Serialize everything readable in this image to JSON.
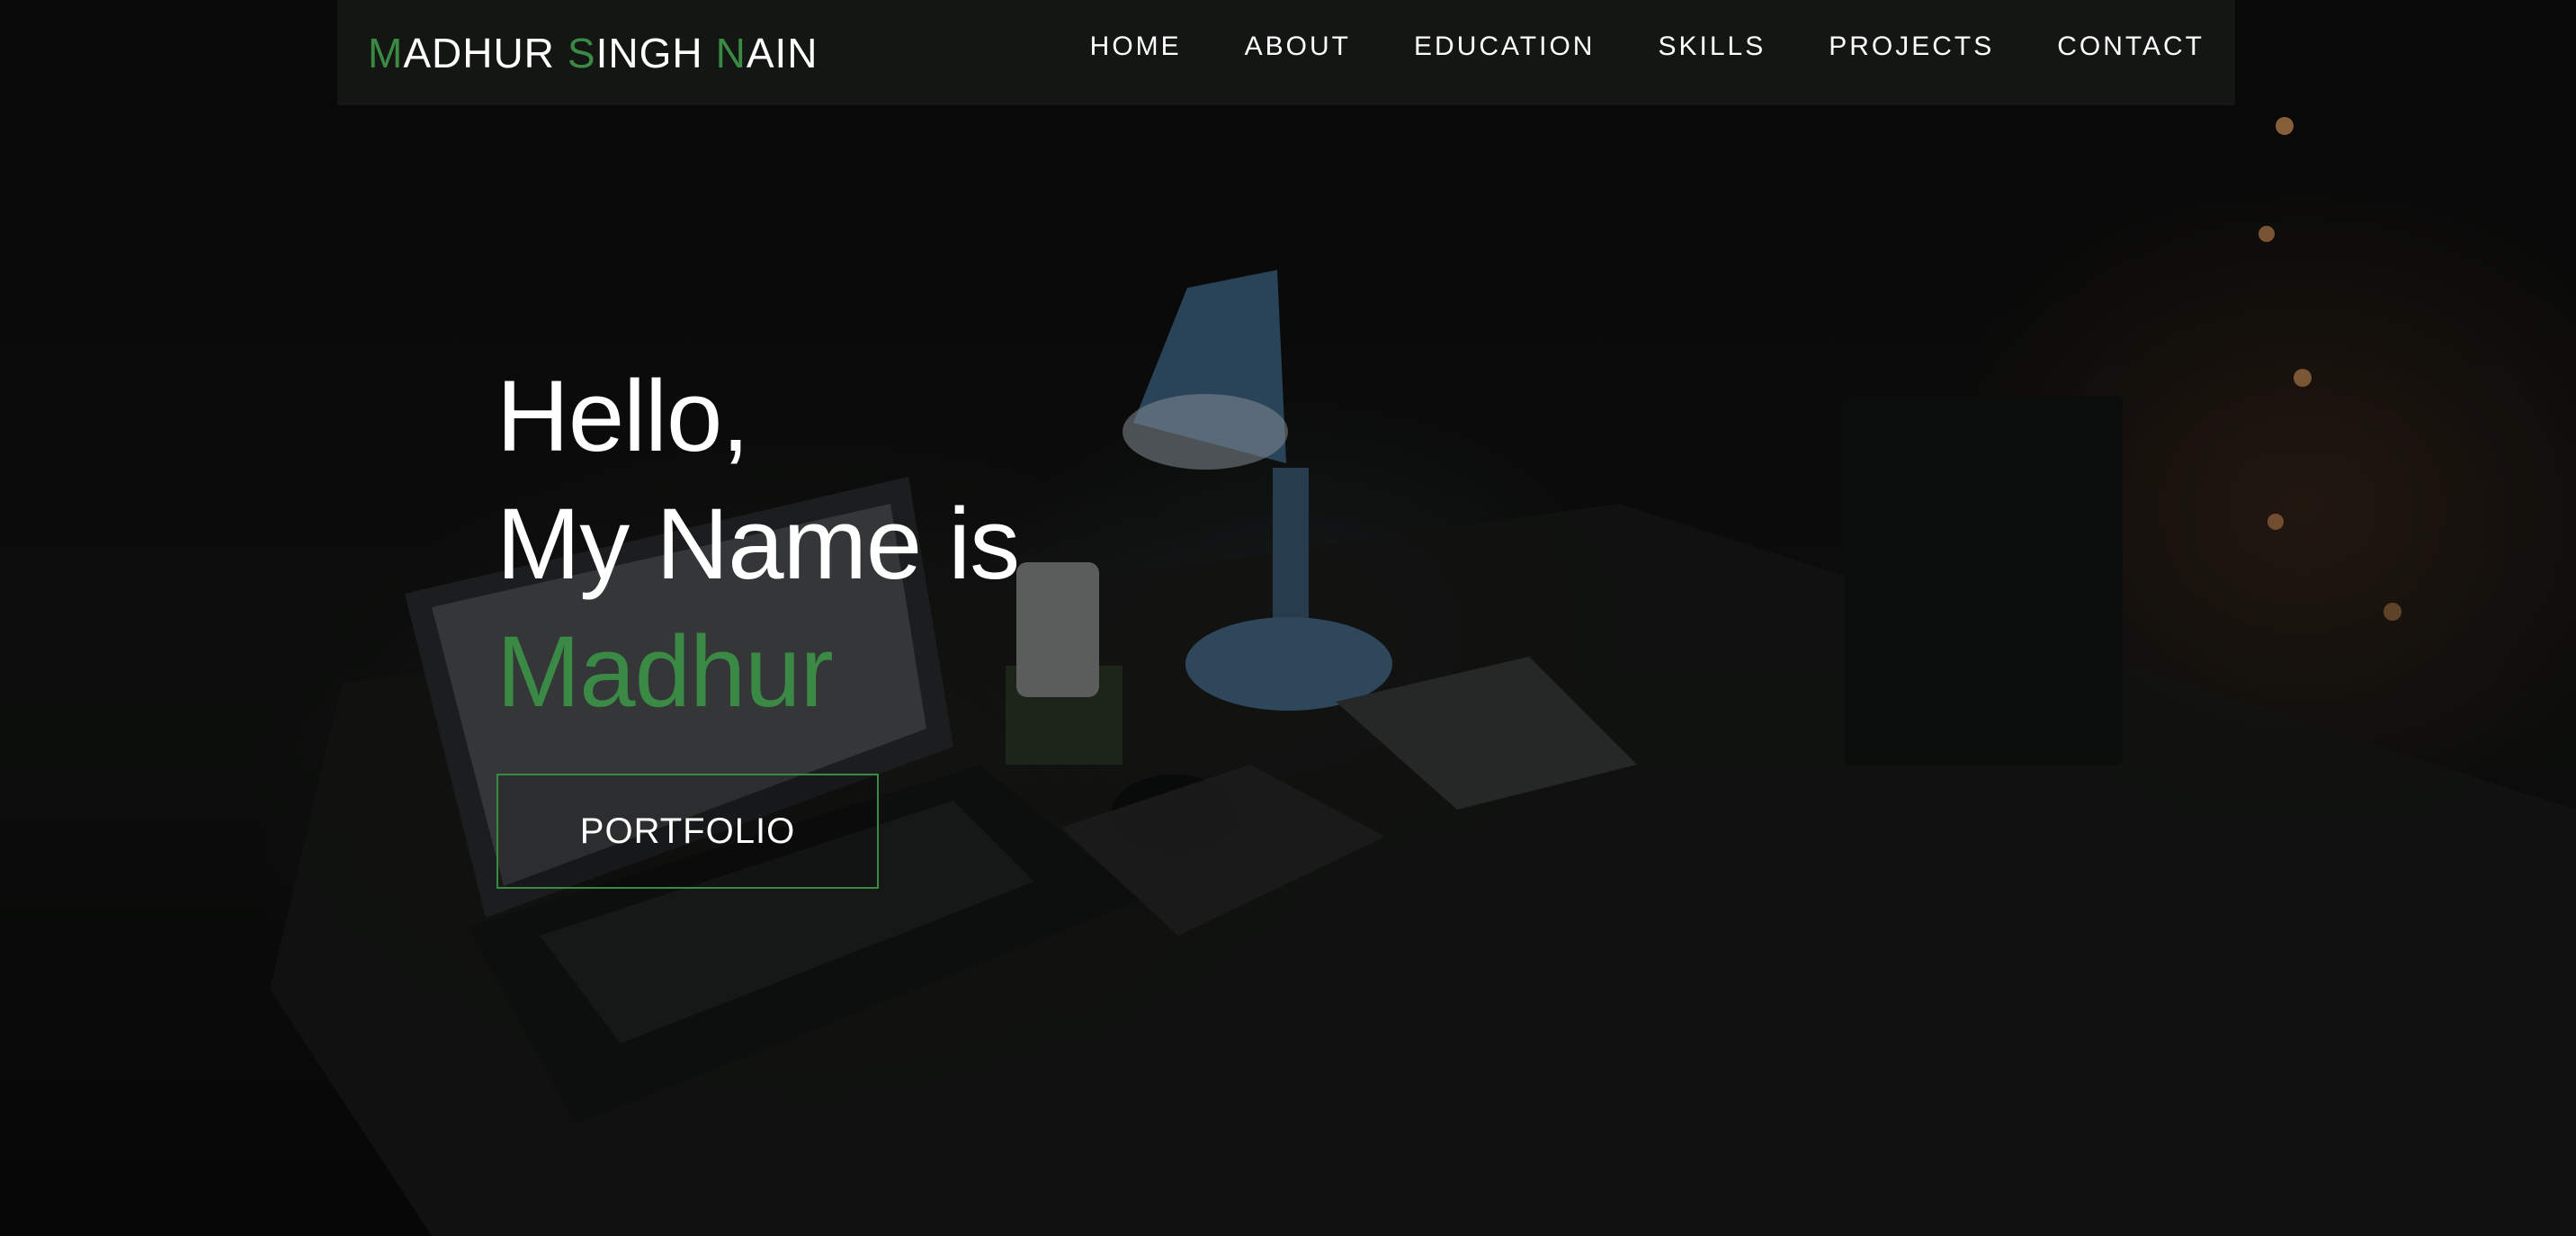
{
  "brand": {
    "words": [
      {
        "initial": "M",
        "rest": "ADHUR"
      },
      {
        "initial": "S",
        "rest": "INGH"
      },
      {
        "initial": "N",
        "rest": "AIN"
      }
    ]
  },
  "nav": {
    "items": [
      "HOME",
      "ABOUT",
      "EDUCATION",
      "SKILLS",
      "PROJECTS",
      "CONTACT"
    ]
  },
  "hero": {
    "line1": "Hello,",
    "line2": "My Name is",
    "name": "Madhur",
    "button_label": "PORTFOLIO"
  },
  "colors": {
    "accent": "#3a8a45",
    "text": "#ffffff",
    "background": "#0b0c0b"
  },
  "icons": [
    "background-photo"
  ]
}
